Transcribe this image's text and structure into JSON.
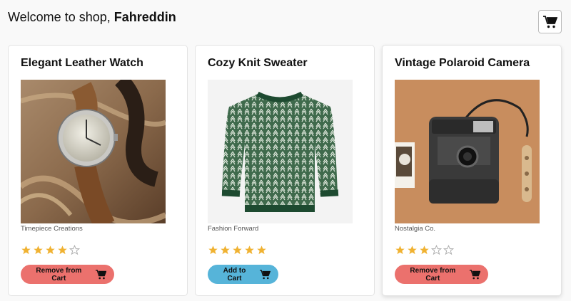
{
  "header": {
    "greeting": "Welcome to shop,",
    "username": "Fahreddin"
  },
  "cart_button": {
    "icon": "cart-icon"
  },
  "colors": {
    "star_filled": "#f0b232",
    "remove_btn": "#eb716d",
    "add_btn": "#56b4d9"
  },
  "products": [
    {
      "title": "Elegant Leather Watch",
      "brand": "Timepiece Creations",
      "rating": 4,
      "max_rating": 5,
      "action_label": "Remove from Cart",
      "action": "remove",
      "image": "wristwatch-photo"
    },
    {
      "title": "Cozy Knit Sweater",
      "brand": "Fashion Forward",
      "rating": 5,
      "max_rating": 5,
      "action_label": "Add to Cart",
      "action": "add",
      "image": "sweater-photo"
    },
    {
      "title": "Vintage Polaroid Camera",
      "brand": "Nostalgia Co.",
      "rating": 3,
      "max_rating": 5,
      "action_label": "Remove from Cart",
      "action": "remove",
      "image": "polaroid-camera-photo"
    }
  ]
}
